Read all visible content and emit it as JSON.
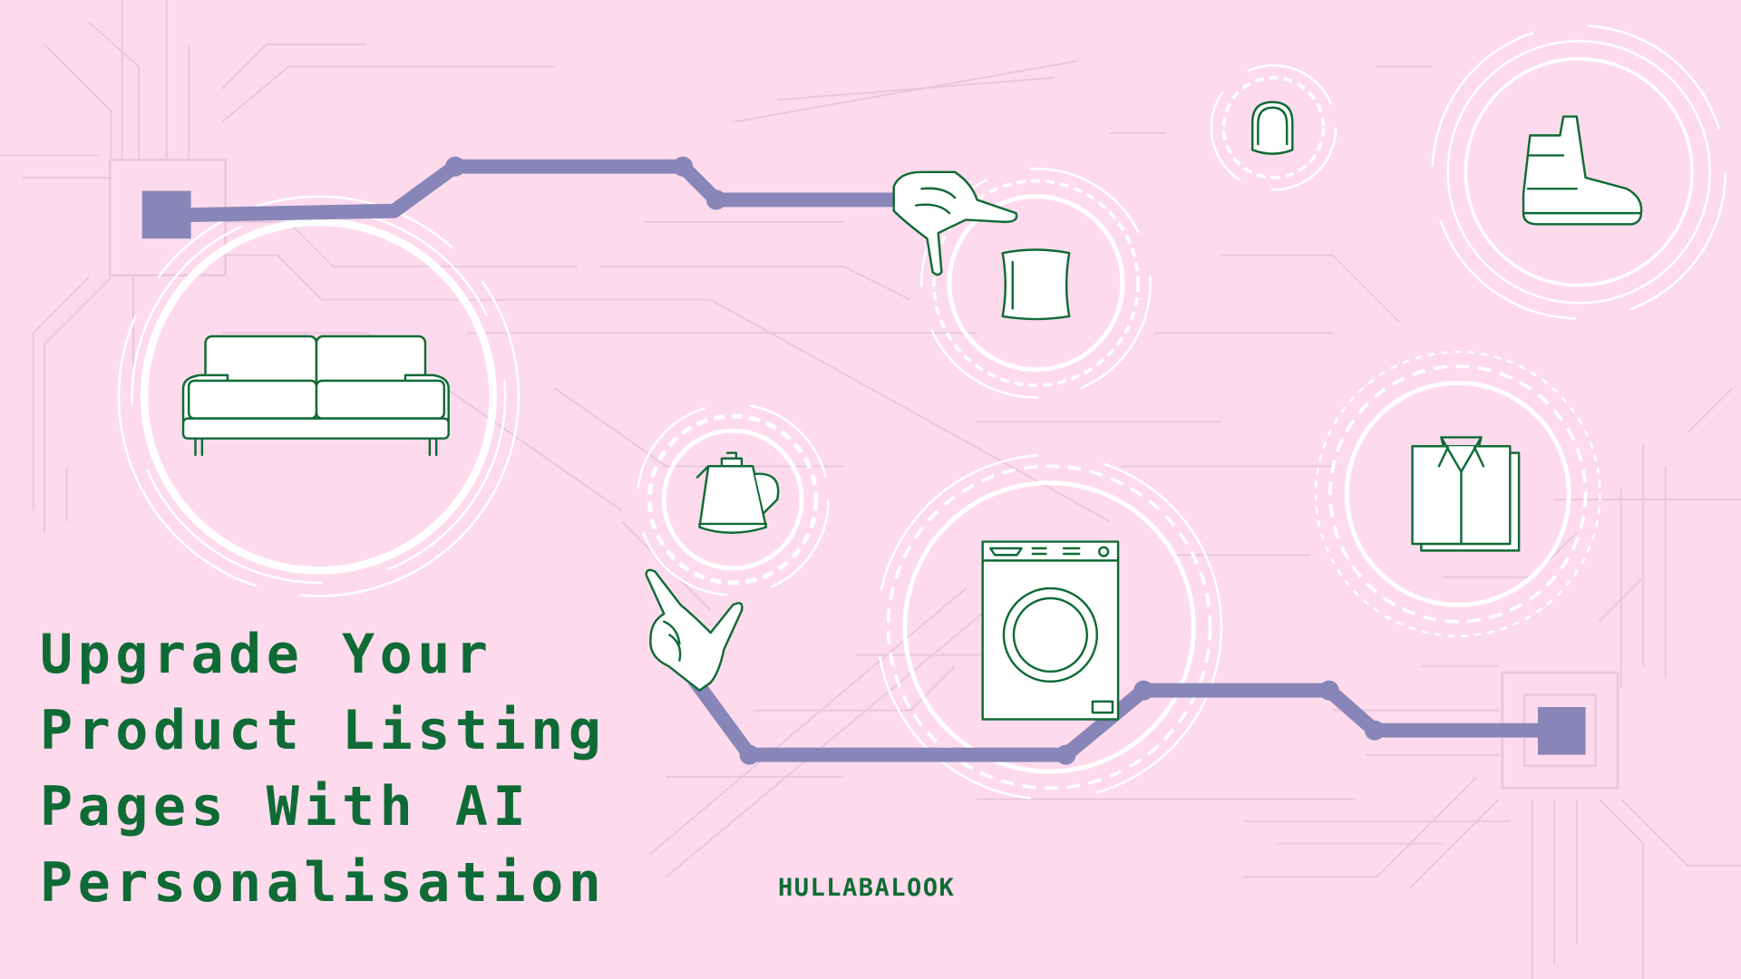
{
  "headline": {
    "lines": [
      "Upgrade Your",
      "Product Listing",
      "Pages With AI",
      "Personalisation"
    ]
  },
  "brand": {
    "name": "HULLABALOOK"
  },
  "colors": {
    "background": "#fddbec",
    "text": "#0f6b35",
    "path": "#8886b8",
    "rings": "#ffffff",
    "traces": "#e8c6dc"
  },
  "illustrations": [
    "sofa-icon",
    "cushion-icon",
    "mirror-icon",
    "boot-icon",
    "kettle-icon",
    "washing-machine-icon",
    "shirt-icon",
    "pointing-hand-icon",
    "grabbing-hand-icon"
  ]
}
